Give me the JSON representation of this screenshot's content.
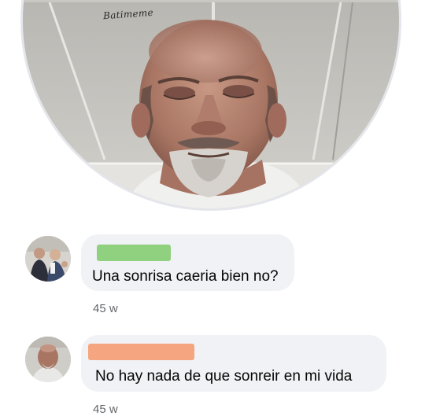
{
  "post": {
    "watermark": "Batimeme"
  },
  "comments": [
    {
      "text": "Una sonrisa caeria bien no?",
      "timestamp": "45 w",
      "name_redaction_color": "#8fd17f"
    },
    {
      "text": "No hay nada de que sonreir en mi vida",
      "timestamp": "45 w",
      "name_redaction_color": "#f5a57f"
    }
  ],
  "colors": {
    "bubble": "#f0f2f5",
    "timestamp": "#65676b",
    "text": "#050505"
  }
}
